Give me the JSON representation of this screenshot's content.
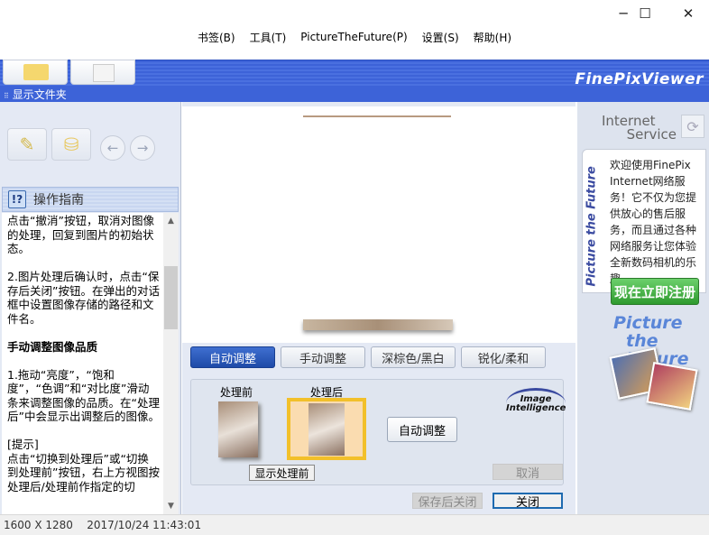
{
  "window": {
    "minimize": "─",
    "maximize": "☐",
    "close": "✕"
  },
  "menu": [
    "书签(B)",
    "工具(T)",
    "PictureTheFuture(P)",
    "设置(S)",
    "帮助(H)"
  ],
  "header": {
    "logo": "FinePixViewer",
    "folder_bar": "显示文件夹"
  },
  "left": {
    "guide_title": "操作指南",
    "guide_icon": "!?",
    "paragraphs": [
      "点击“撤消”按钮，取消对图像的处理，回复到图片的初始状态。",
      "2.图片处理后确认时，点击“保存后关闭”按钮。在弹出的对话框中设置图像存储的路径和文件名。"
    ],
    "heading": "手动调整图像品质",
    "paragraphs2": [
      "1.拖动“亮度”，“饱和度”，“色调”和“对比度”滑动条来调整图像的品质。在“处理后”中会显示出调整后的图像。",
      "[提示]\n点击“切换到处理后”或“切换到处理前”按钮，右上方视图按处理后/处理前作指定的切"
    ]
  },
  "tabs": [
    "自动调整",
    "手动调整",
    "深棕色/黑白",
    "锐化/柔和"
  ],
  "panel": {
    "before": "处理前",
    "after": "处理后",
    "auto_button": "自动调整",
    "show_before": "显示处理前",
    "cancel": "取消",
    "logo_line1": "Image",
    "logo_line2": "Intelligence"
  },
  "footer": {
    "save_close": "保存后关闭",
    "close": "关闭"
  },
  "right": {
    "service1": "Internet",
    "service2": "Service",
    "vertical": "Picture the Future",
    "info": "欢迎使用FinePix Internet网络服务！它不仅为您提供放心的售后服务，而且通过各种网络服务让您体验全新数码相机的乐趣。",
    "register": "现在立即注册",
    "promo1": "Picture",
    "promo2": "the Future"
  },
  "status": {
    "resolution": "1600 X 1280",
    "datetime": "2017/10/24 11:43:01"
  }
}
